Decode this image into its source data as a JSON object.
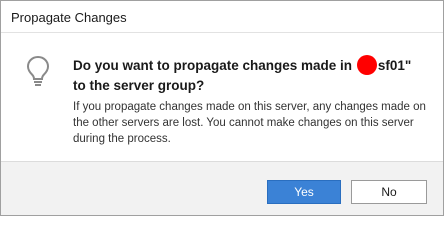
{
  "dialog": {
    "title": "Propagate Changes",
    "heading_part1": "Do you want to propagate changes made in",
    "heading_part2": "sf01\" to the server group?",
    "description": "If you propagate changes made on this server, any changes made on the other servers are lost. You cannot make changes on this server during the process.",
    "icon": "lightbulb-icon",
    "redaction_color": "#ff0000"
  },
  "buttons": {
    "yes_label": "Yes",
    "no_label": "No",
    "primary_color": "#3b82d6"
  }
}
